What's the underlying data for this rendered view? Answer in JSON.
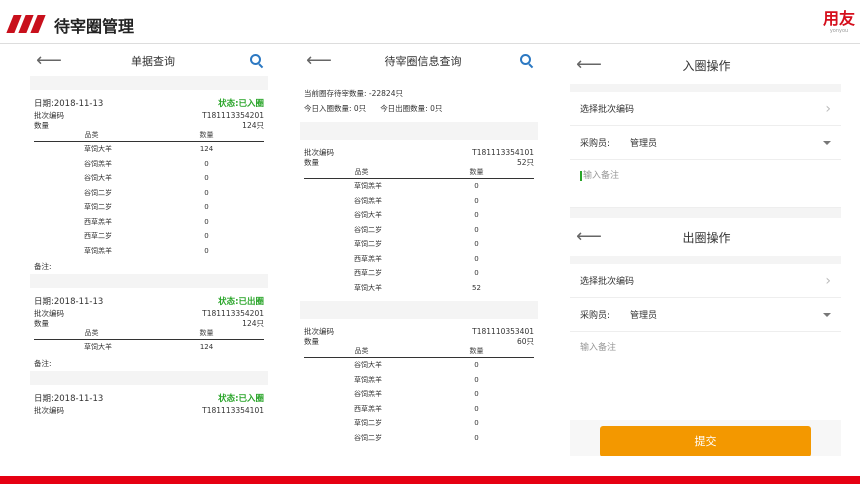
{
  "slide": {
    "title": "待宰圈管理",
    "brand": {
      "name": "用友",
      "sub": "yonyou"
    },
    "colors": {
      "accent_red": "#e60012",
      "status_green": "#2aa52a",
      "search_blue": "#2b78c2",
      "submit_orange": "#f39800"
    }
  },
  "panel1": {
    "title": "单据查询",
    "back_icon": "arrow-left-icon",
    "search_icon": "search-icon",
    "records": [
      {
        "date": "日期:2018-11-13",
        "status": "状态:已入圈",
        "batch_label": "批次编码",
        "batch_value": "T181113354201",
        "qty_label": "数量",
        "qty_value": "124只",
        "col_type": "品类",
        "col_qty": "数量",
        "rows": [
          {
            "name": "草饲大羊",
            "qty": "124"
          },
          {
            "name": "谷饲羔羊",
            "qty": "0"
          },
          {
            "name": "谷饲大羊",
            "qty": "0"
          },
          {
            "name": "谷饲二岁",
            "qty": "0"
          },
          {
            "name": "草饲二岁",
            "qty": "0"
          },
          {
            "name": "西草羔羊",
            "qty": "0"
          },
          {
            "name": "西草二岁",
            "qty": "0"
          },
          {
            "name": "草饲羔羊",
            "qty": "0"
          }
        ],
        "remark": "备注:"
      },
      {
        "date": "日期:2018-11-13",
        "status": "状态:已出圈",
        "batch_label": "批次编码",
        "batch_value": "T181113354201",
        "qty_label": "数量",
        "qty_value": "124只",
        "col_type": "品类",
        "col_qty": "数量",
        "rows": [
          {
            "name": "草饲大羊",
            "qty": "124"
          }
        ],
        "remark": "备注:"
      },
      {
        "date": "日期:2018-11-13",
        "status": "状态:已入圈",
        "batch_label": "批次编码",
        "batch_value": "T181113354101"
      }
    ]
  },
  "panel2": {
    "title": "待宰圈信息查询",
    "back_icon": "arrow-left-icon",
    "search_icon": "search-icon",
    "summary": {
      "stock": "当前圈存待宰数量: -22824只",
      "today_in": "今日入圈数量: 0只",
      "today_out": "今日出圈数量: 0只"
    },
    "batches": [
      {
        "batch_label": "批次编码",
        "batch_value": "T181113354101",
        "qty_label": "数量",
        "qty_value": "52只",
        "col_type": "品类",
        "col_qty": "数量",
        "rows": [
          {
            "name": "草饲羔羊",
            "qty": "0"
          },
          {
            "name": "谷饲羔羊",
            "qty": "0"
          },
          {
            "name": "谷饲大羊",
            "qty": "0"
          },
          {
            "name": "谷饲二岁",
            "qty": "0"
          },
          {
            "name": "草饲二岁",
            "qty": "0"
          },
          {
            "name": "西草羔羊",
            "qty": "0"
          },
          {
            "name": "西草二岁",
            "qty": "0"
          },
          {
            "name": "草饲大羊",
            "qty": "52"
          }
        ]
      },
      {
        "batch_label": "批次编码",
        "batch_value": "T181110353401",
        "qty_label": "数量",
        "qty_value": "60只",
        "col_type": "品类",
        "col_qty": "数量",
        "rows": [
          {
            "name": "谷饲大羊",
            "qty": "0"
          },
          {
            "name": "草饲羔羊",
            "qty": "0"
          },
          {
            "name": "谷饲羔羊",
            "qty": "0"
          },
          {
            "name": "西草羔羊",
            "qty": "0"
          },
          {
            "name": "草饲二岁",
            "qty": "0"
          },
          {
            "name": "谷饲二岁",
            "qty": "0"
          }
        ]
      }
    ]
  },
  "panel3": {
    "in_op": {
      "title": "入圈操作",
      "select_batch": "选择批次编码",
      "buyer_label": "采购员:",
      "buyer_value": "管理员",
      "memo_placeholder": "输入备注"
    },
    "out_op": {
      "title": "出圈操作",
      "select_batch": "选择批次编码",
      "buyer_label": "采购员:",
      "buyer_value": "管理员",
      "memo_placeholder": "输入备注"
    },
    "submit_label": "提交"
  }
}
